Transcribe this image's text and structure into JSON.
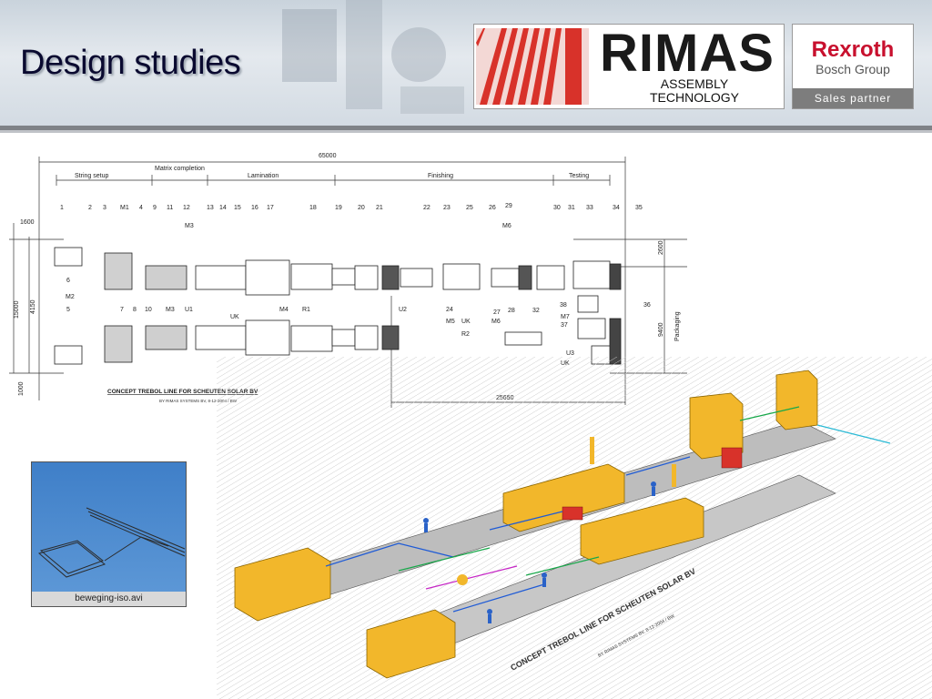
{
  "slide": {
    "title": "Design studies"
  },
  "logos": {
    "rimas": {
      "name": "RIMAS",
      "line1": "ASSEMBLY",
      "line2": "TECHNOLOGY"
    },
    "rexroth": {
      "brand": "Rexroth",
      "group": "Bosch Group",
      "badge": "Sales partner"
    }
  },
  "layout_drawing": {
    "overall_length": "65000",
    "sections": [
      "String setup",
      "Matrix completion",
      "Lamination",
      "Finishing",
      "Testing"
    ],
    "dimensions": {
      "left_offset": "1600",
      "height_total": "15000",
      "height_inner": "4150",
      "bottom_offset": "1000",
      "finishing_span": "25650",
      "right_top": "2600",
      "right_height": "9400"
    },
    "side_label": "Packaging",
    "station_numbers": [
      "1",
      "2",
      "3",
      "M1",
      "4",
      "9",
      "11",
      "12",
      "13",
      "14",
      "15",
      "16",
      "17",
      "18",
      "19",
      "20",
      "21",
      "22",
      "23",
      "25",
      "26",
      "29",
      "M6",
      "30",
      "31",
      "33",
      "34",
      "35"
    ],
    "left_labels": [
      "6",
      "M2",
      "5",
      "7",
      "8",
      "10",
      "M3",
      "U1",
      "M3",
      "UK",
      "M4",
      "R1"
    ],
    "middle_labels": [
      "U2",
      "24",
      "M5",
      "UK",
      "R2",
      "27",
      "M6",
      "28",
      "32",
      "38",
      "M7",
      "37",
      "36",
      "U3",
      "UK"
    ],
    "caption": "CONCEPT TREBOL LINE FOR SCHEUTEN SOLAR BV",
    "subcaption": "BY RIMAS SYSTEMS BV, 8-12-2004 / BW"
  },
  "iso_view": {
    "caption": "CONCEPT TREBOL LINE FOR SCHEUTEN SOLAR BV",
    "subcaption": "BY RIMAS SYSTEMS BV, 8-12-2004 / BW"
  },
  "video": {
    "filename": "beweging-iso.avi"
  },
  "colors": {
    "title": "#0a0a30",
    "rexroth_red": "#c8102e",
    "machine_yellow": "#f2b72b",
    "rimas_red": "#d8322a"
  }
}
